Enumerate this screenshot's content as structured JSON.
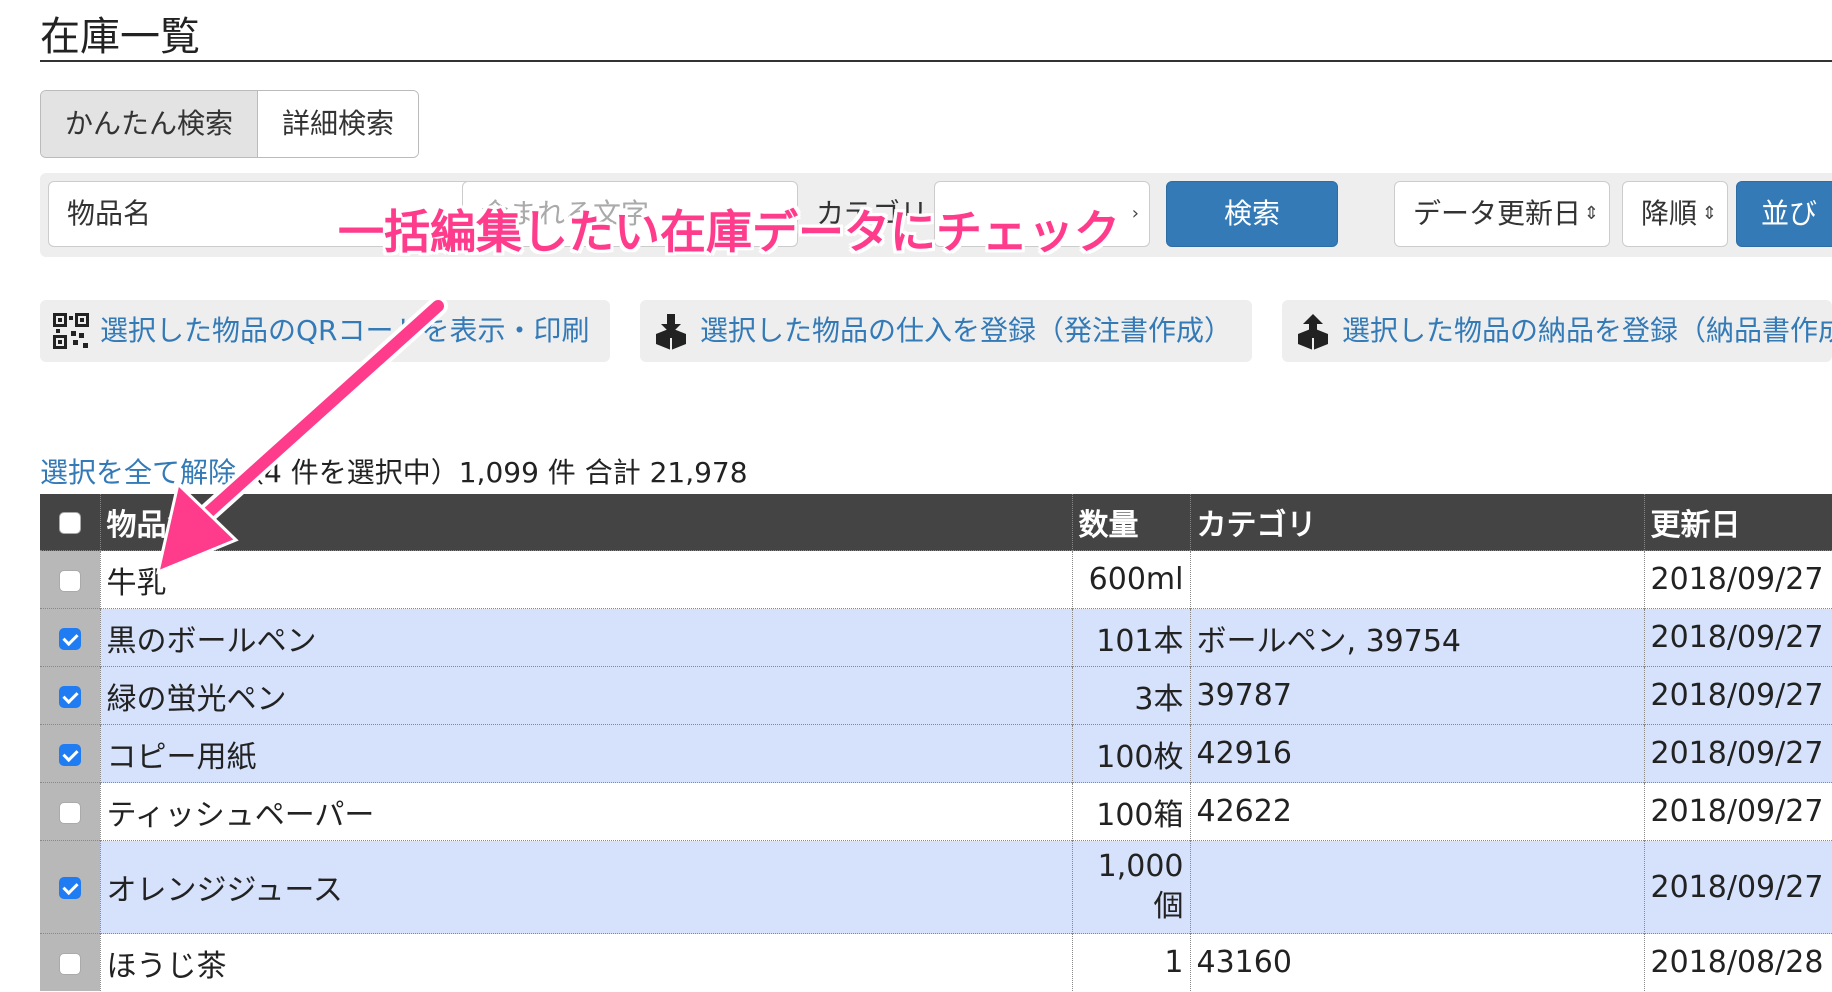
{
  "page": {
    "title": "在庫一覧"
  },
  "search_tabs": [
    {
      "label": "かんたん検索",
      "active": true
    },
    {
      "label": "詳細検索",
      "active": false
    }
  ],
  "search": {
    "field_select": "物品名",
    "keyword_placeholder": "含まれる文字",
    "category_label": "カテゴリ",
    "category_value": "",
    "search_button": "検索",
    "sort_field": "データ更新日",
    "sort_order": "降順",
    "sort_button": "並び替"
  },
  "annotation": {
    "text": "一括編集したい在庫データにチェック",
    "color": "#ff3c8c"
  },
  "actions": {
    "qr": "選択した物品のQRコードを表示・印刷",
    "purchase": "選択した物品の仕入を登録（発注書作成）",
    "delivery": "選択した物品の納品を登録（納品書作成"
  },
  "summary": {
    "deselect_link": "選択を全て解除",
    "rest": "（4 件を選択中）1,099 件 合計 21,978"
  },
  "table": {
    "columns": [
      "物品名",
      "数量",
      "カテゴリ",
      "更新日"
    ],
    "rows": [
      {
        "name": "牛乳",
        "qty": "600ml",
        "category": "",
        "updated": "2018/09/27",
        "checked": false
      },
      {
        "name": "黒のボールペン",
        "qty": "101本",
        "category": "ボールペン, 39754",
        "updated": "2018/09/27",
        "checked": true
      },
      {
        "name": "緑の蛍光ペン",
        "qty": "3本",
        "category": "39787",
        "updated": "2018/09/27",
        "checked": true
      },
      {
        "name": "コピー用紙",
        "qty": "100枚",
        "category": "42916",
        "updated": "2018/09/27",
        "checked": true
      },
      {
        "name": "ティッシュペーパー",
        "qty": "100箱",
        "category": "42622",
        "updated": "2018/09/27",
        "checked": false
      },
      {
        "name": "オレンジジュース",
        "qty_line1": "1,000",
        "qty_line2": "個",
        "category": "",
        "updated": "2018/09/27",
        "checked": true
      },
      {
        "name": "ほうじ茶",
        "qty": "1",
        "category": "43160",
        "updated": "2018/08/28",
        "checked": false
      }
    ]
  },
  "colors": {
    "link": "#337ab7",
    "primary": "#337ab7",
    "header_bg": "#444444",
    "selected_row": "#d6e2fb"
  }
}
